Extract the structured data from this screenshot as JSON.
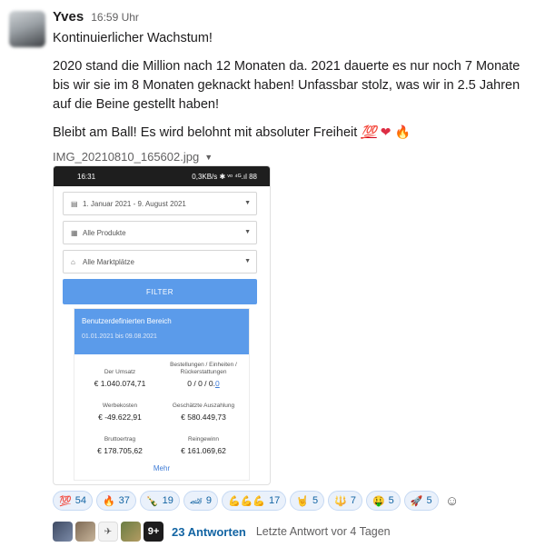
{
  "message": {
    "author": "Yves",
    "time": "16:59 Uhr",
    "line1": "Kontinuierlicher Wachstum!",
    "line2": "2020 stand die Million nach 12 Monaten da. 2021 dauerte es nur noch 7 Monate bis wir sie im 8 Monaten geknackt haben! Unfassbar stolz, was wir in 2.5 Jahren auf die Beine gestellt haben!",
    "line3": "Bleibt am Ball! Es wird belohnt mit absoluter Freiheit",
    "line3_emojis": [
      "💯",
      "❤",
      "🔥"
    ]
  },
  "attachment": {
    "filename": "IMG_20210810_165602.jpg",
    "phone": {
      "status_time": "16:31",
      "status_right": "0,3KB/s ✱ ᵛᵒ ⁴ᴳ.ıl 88",
      "date_range": "1. Januar 2021 - 9. August 2021",
      "products": "Alle Produkte",
      "marketplaces": "Alle Marktplätze",
      "filter_label": "FILTER",
      "card_title": "Benutzerdefinierten Bereich",
      "card_range": "01.01.2021 bis 09.08.2021",
      "metrics": [
        {
          "label": "Der Umsatz",
          "value": "€ 1.040.074,71"
        },
        {
          "label": "Bestellungen / Einheiten / Rückerstattungen",
          "value": "0 / 0 / 0",
          "value_tail": "0"
        },
        {
          "label": "Werbekosten",
          "value": "€ -49.622,91"
        },
        {
          "label": "Geschätzte Auszahlung",
          "value": "€ 580.449,73"
        },
        {
          "label": "Bruttoertrag",
          "value": "€ 178.705,62"
        },
        {
          "label": "Reingewinn",
          "value": "€ 161.069,62"
        }
      ],
      "more_label": "Mehr"
    }
  },
  "reactions": [
    {
      "emoji": "💯",
      "count": "54"
    },
    {
      "emoji": "🔥",
      "count": "37"
    },
    {
      "emoji": "🍾",
      "count": "19"
    },
    {
      "emoji": "🏎",
      "count": "9"
    },
    {
      "emoji": "💪💪💪",
      "count": "17"
    },
    {
      "emoji": "🤘",
      "count": "5"
    },
    {
      "emoji": "🔱",
      "count": "7"
    },
    {
      "emoji": "🤑",
      "count": "5"
    },
    {
      "emoji": "🚀",
      "count": "5"
    }
  ],
  "thread": {
    "more_badge": "9+",
    "replies": "23 Antworten",
    "last_reply": "Letzte Antwort vor 4 Tagen"
  },
  "colors": {
    "link": "#1264a3",
    "accent": "#5b9bea"
  }
}
